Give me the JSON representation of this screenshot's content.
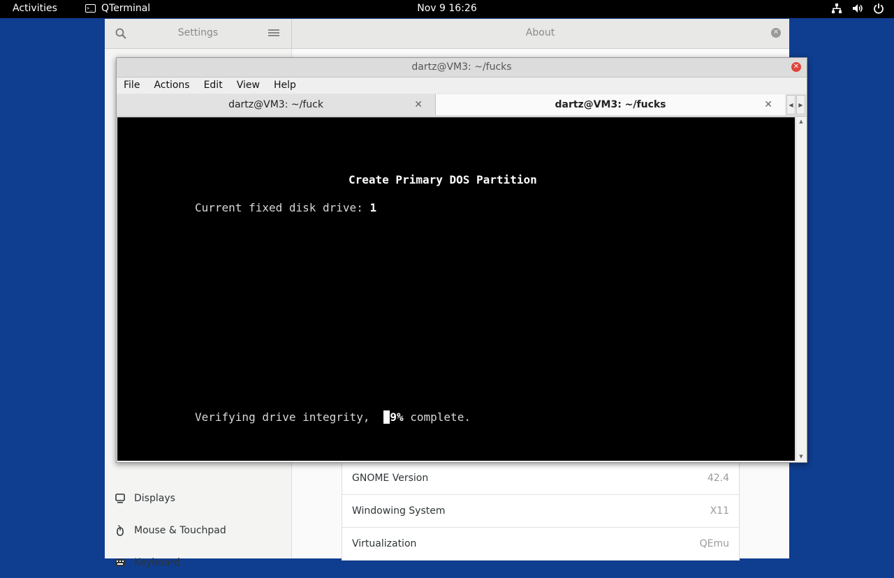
{
  "topbar": {
    "activities": "Activities",
    "app_name": "QTerminal",
    "app_icon": "terminal-icon",
    "clock": "Nov 9  16:26",
    "tray_icons": [
      "network-icon",
      "volume-icon",
      "power-icon"
    ]
  },
  "settings": {
    "sidebar_title": "Settings",
    "main_title": "About",
    "sidebar_items": [
      {
        "label": "Displays",
        "icon": "display-icon"
      },
      {
        "label": "Mouse & Touchpad",
        "icon": "mouse-icon"
      },
      {
        "label": "Keyboard",
        "icon": "keyboard-icon"
      }
    ],
    "about_rows": [
      {
        "key": "GNOME Version",
        "value": "42.4"
      },
      {
        "key": "Windowing System",
        "value": "X11"
      },
      {
        "key": "Virtualization",
        "value": "QEmu"
      }
    ]
  },
  "terminal": {
    "window_title": "dartz@VM3: ~/fucks",
    "menu": [
      "File",
      "Actions",
      "Edit",
      "View",
      "Help"
    ],
    "tabs": [
      {
        "label": "dartz@VM3: ~/fuck",
        "active": false
      },
      {
        "label": "dartz@VM3: ~/fucks",
        "active": true
      }
    ],
    "screen": {
      "heading": "Create Primary DOS Partition",
      "drive_label": "Current fixed disk drive: ",
      "drive_value": "1",
      "verify_prefix": "Verifying drive integrity,  ",
      "percent_first_digit": "1",
      "percent_rest": "9%",
      "verify_suffix": " complete."
    }
  }
}
